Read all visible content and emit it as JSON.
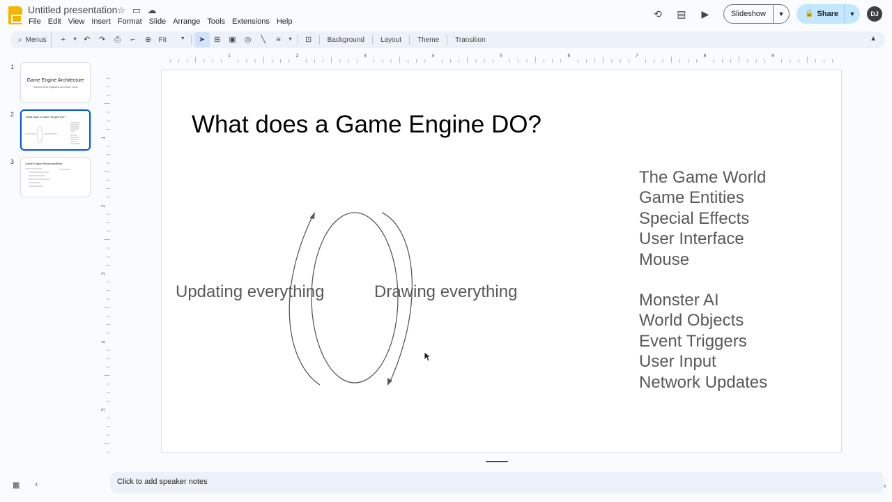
{
  "app": {
    "doc_title": "Untitled presentation"
  },
  "menubar": [
    "File",
    "Edit",
    "View",
    "Insert",
    "Format",
    "Slide",
    "Arrange",
    "Tools",
    "Extensions",
    "Help"
  ],
  "header": {
    "slideshow_label": "Slideshow",
    "share_label": "Share",
    "avatar_initials": "DJ"
  },
  "toolbar": {
    "search_label": "Menus",
    "zoom_value": "Fit",
    "background_label": "Background",
    "layout_label": "Layout",
    "theme_label": "Theme",
    "transition_label": "Transition"
  },
  "ruler": {
    "horizontal": [
      "1",
      "2",
      "3",
      "4",
      "5",
      "6",
      "7",
      "8",
      "9"
    ],
    "vertical": [
      "1",
      "2",
      "3",
      "4",
      "5"
    ]
  },
  "filmstrip": {
    "slides": [
      {
        "number": "1",
        "title": "Game Engine Architecture",
        "subtitle": "How this is all organized as a video mmm"
      },
      {
        "number": "2",
        "title": "What does a Game Engine DO?"
      },
      {
        "number": "3",
        "title": "Game Engine Responsibilities"
      }
    ]
  },
  "slide": {
    "title": "What does a Game Engine DO?",
    "label_left": "Updating everything",
    "label_right": "Drawing everything",
    "list_group1": [
      "The Game World",
      "Game Entities",
      "Special Effects",
      "User Interface",
      "Mouse"
    ],
    "list_group2": [
      "Monster AI",
      "World Objects",
      "Event Triggers",
      "User Input",
      "Network Updates"
    ]
  },
  "notes": {
    "placeholder": "Click to add speaker notes"
  }
}
